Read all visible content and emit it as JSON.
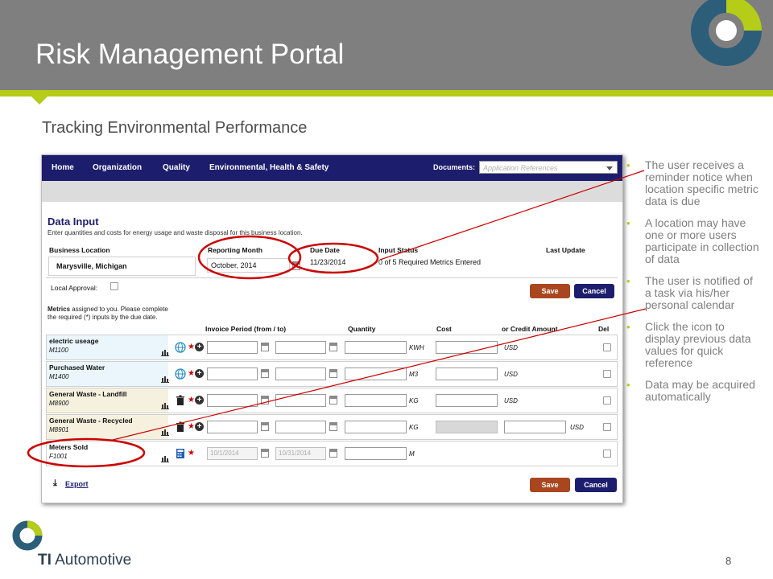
{
  "slide": {
    "title": "Risk Management Portal",
    "subtitle": "Tracking Environmental Performance",
    "page_number": "8",
    "brand_prefix": "TI",
    "brand_name": " Automotive",
    "colors": {
      "header": "#7f7f7f",
      "accent": "#b5cc18",
      "nav": "#1d1d6e",
      "save": "#a9461f",
      "annotation": "#cc0000"
    }
  },
  "app": {
    "nav": {
      "home": "Home",
      "organization": "Organization",
      "quality": "Quality",
      "ehs": "Environmental, Health & Safety",
      "documents_label": "Documents:",
      "documents_placeholder": "Application References"
    },
    "data_input": {
      "title": "Data Input",
      "description": "Enter quantities and costs for energy usage and waste disposal for this business location.",
      "business_location_label": "Business Location",
      "business_location_value": "Marysville, Michigan",
      "reporting_month_label": "Reporting Month",
      "reporting_month_value": "October, 2014",
      "due_date_label": "Due Date",
      "due_date_value": "11/23/2014",
      "input_status_label": "Input Status",
      "input_status_value": "0 of 5 Required Metrics Entered",
      "last_update_label": "Last Update",
      "local_approval_label": "Local Approval:",
      "save_label": "Save",
      "cancel_label": "Cancel",
      "metrics_note_bold": "Metrics",
      "metrics_note_rest": " assigned to you. Please complete the required (*) inputs by the due date.",
      "export_label": "Export"
    },
    "columns": {
      "invoice_period": "Invoice Period (from / to)",
      "quantity": "Quantity",
      "cost": "Cost",
      "credit": "or Credit Amount",
      "del": "Del"
    },
    "metrics": [
      {
        "name": "electric useage",
        "code": "M1100",
        "unit": "KWH",
        "currency": "USD",
        "icon": "globe-icon",
        "bg": "#eaf6fb"
      },
      {
        "name": "Purchased Water",
        "code": "M1400",
        "unit": "M3",
        "currency": "USD",
        "icon": "globe-icon",
        "bg": "#eaf6fb"
      },
      {
        "name": "General Waste - Landfill",
        "code": "M8900",
        "unit": "KG",
        "currency": "USD",
        "icon": "trash-icon",
        "bg": "#f5f1de"
      },
      {
        "name": "General Waste - Recycled",
        "code": "M8901",
        "unit": "KG",
        "currency": "USD",
        "icon": "trash-icon",
        "bg": "#f5f1de"
      },
      {
        "name": "Meters Sold",
        "code": "F1001",
        "unit": "M",
        "from": "10/1/2014",
        "to": "10/31/2014",
        "icon": "calculator-icon",
        "bg": "#ffffff"
      }
    ]
  },
  "bullets": [
    "The user receives a reminder notice when location specific metric data is due",
    "A location may have one or more users participate in collection of data",
    "The user is notified of a task via his/her personal calendar",
    "Click the icon to display previous data values for quick reference",
    "Data may be acquired automatically"
  ]
}
